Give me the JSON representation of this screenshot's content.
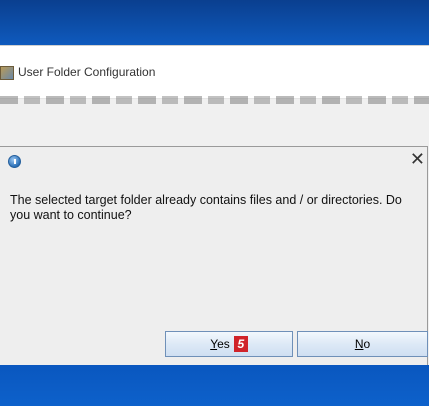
{
  "main_window": {
    "title": "User Folder Configuration"
  },
  "dialog": {
    "message": "The selected target folder already contains files and / or directories. Do you want to continue?",
    "buttons": {
      "yes_label": "Yes",
      "no_label": "No"
    },
    "step_badge": "5"
  },
  "colors": {
    "desktop_blue": "#1466cf",
    "badge_red": "#d0232a",
    "dialog_bg": "#eeeeee"
  },
  "icons": {
    "app": "app-icon",
    "info": "info-icon",
    "close": "close-icon"
  }
}
